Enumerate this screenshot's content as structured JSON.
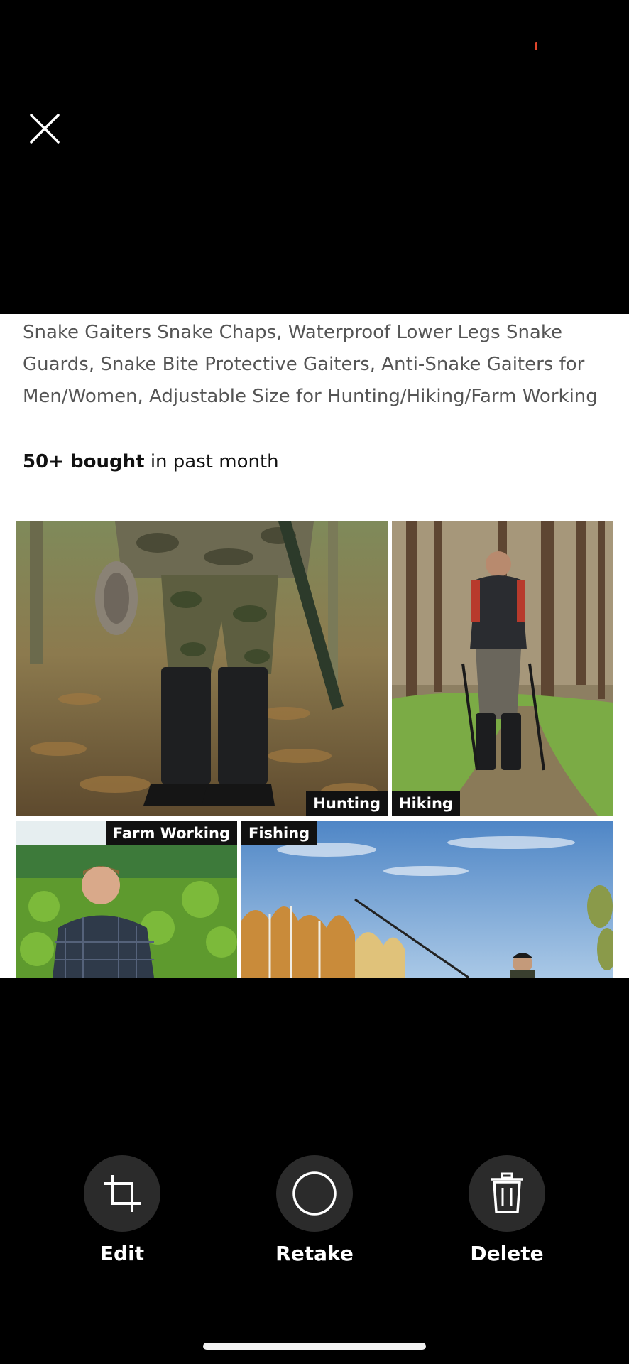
{
  "product": {
    "title": "Snake Gaiters Snake Chaps, Waterproof Lower Legs Snake Guards, Snake Bite Protective Gaiters, Anti-Snake Gaiters for Men/Women, Adjustable Size for Hunting/Hiking/Farm Working",
    "bought_count": "50+ bought",
    "bought_suffix": " in past month"
  },
  "image_labels": {
    "hunting": "Hunting",
    "hiking": "Hiking",
    "farm_working": "Farm Working",
    "fishing": "Fishing"
  },
  "actions": {
    "edit": "Edit",
    "retake": "Retake",
    "delete": "Delete"
  },
  "icons": {
    "close": "close-icon",
    "edit": "crop-icon",
    "retake": "circle-icon",
    "delete": "trash-icon"
  },
  "colors": {
    "background": "#000000",
    "button_bg": "#2b2b2b",
    "status_accent": "#e0452b"
  }
}
